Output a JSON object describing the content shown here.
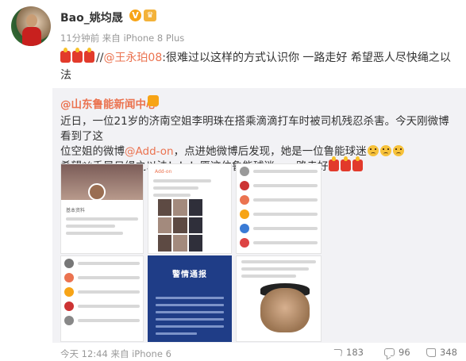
{
  "user": {
    "name": "Bao_姚均晟",
    "verified_mark": "V",
    "meta": "11分钟前 来自 iPhone 8 Plus"
  },
  "post": {
    "prefix": "//",
    "mention": "@王永珀08",
    "text_line1": ":很难过以这样的方式认识你 一路走好 希望恶人尽快绳之以",
    "text_line2": "法"
  },
  "repost": {
    "author": "@山东鲁能新闻中心",
    "line1": "近日，一位21岁的济南空姐李明珠在搭乘滴滴打车时被司机残忍杀害。今天刚微博看到了这",
    "line2a": "位空姐的微博",
    "line2_mention": "@Add-on",
    "line2b": "，点进她微博后发现，她是一位鲁能球迷",
    "line3": "希望凶手早日绳之以法！！！愿这位鲁能球迷，一路走好"
  },
  "images": {
    "t1_label": "基本资料",
    "t2_name": "Add-on",
    "notice_title": "警情通报"
  },
  "footer": {
    "meta": "今天 12:44 来自 iPhone 6",
    "shares": "183",
    "comments": "96",
    "likes": "348"
  },
  "colors": {
    "mention": "#eb7350",
    "repost_bg": "#f2f2f5",
    "notice_bg": "#1f3d87"
  }
}
